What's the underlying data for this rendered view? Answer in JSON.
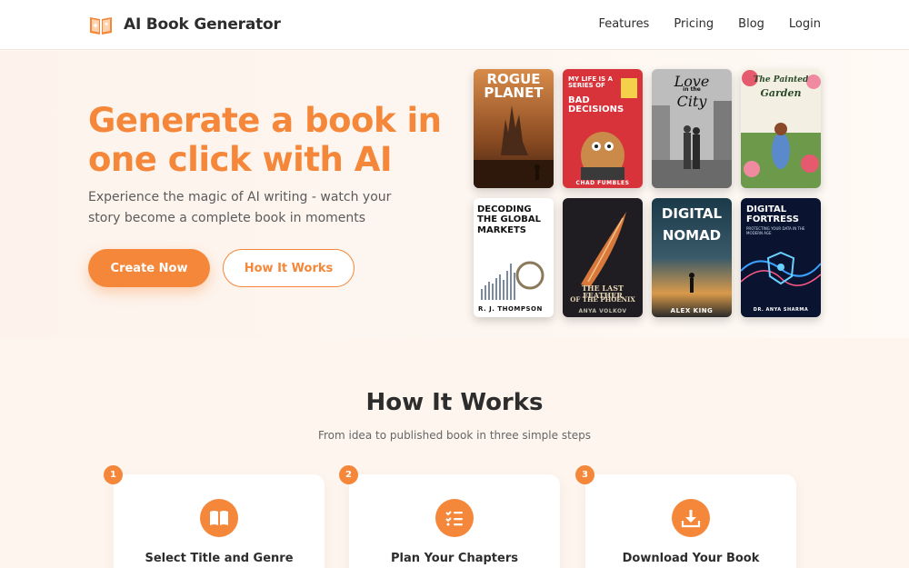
{
  "brand": {
    "name": "AI Book Generator",
    "icon": "open-book-icon"
  },
  "nav": {
    "links": [
      "Features",
      "Pricing",
      "Blog",
      "Login"
    ]
  },
  "hero": {
    "title": "Generate a book in one click with AI",
    "subtitle": "Experience the magic of AI writing - watch your story become a complete book in moments",
    "primary_button": "Create Now",
    "secondary_button": "How It Works"
  },
  "covers": [
    {
      "title_line1": "ROGUE",
      "title_line2": "PLANET",
      "author": ""
    },
    {
      "title_line1": "MY LIFE IS A SERIES OF",
      "title_line2": "BAD DECISIONS",
      "author": "CHAD FUMBLES"
    },
    {
      "title_line1": "Love",
      "title_line2": "City",
      "small": "in the",
      "author": ""
    },
    {
      "title_line1": "The Painted",
      "title_line2": "Garden",
      "author": ""
    },
    {
      "title_line1": "DECODING THE GLOBAL",
      "title_line2": "MARKETS",
      "author": "R. J. THOMPSON"
    },
    {
      "title_line1": "THE LAST FEATHER",
      "title_line2": "OF THE PHOENIX",
      "author": "ANYA VOLKOV"
    },
    {
      "title_line1": "DIGITAL",
      "title_line2": "NOMAD",
      "author": "ALEX KING"
    },
    {
      "title_line1": "DIGITAL",
      "title_line2": "FORTRESS",
      "small": "PROTECTING YOUR DATA IN THE MODERN AGE",
      "author": "DR. ANYA SHARMA"
    }
  ],
  "how_it_works": {
    "title": "How It Works",
    "subtitle": "From idea to published book in three simple steps",
    "steps": [
      {
        "number": "1",
        "label": "Select Title and Genre",
        "icon": "book-icon"
      },
      {
        "number": "2",
        "label": "Plan Your Chapters",
        "icon": "checklist-icon"
      },
      {
        "number": "3",
        "label": "Download Your Book",
        "icon": "download-icon"
      }
    ]
  },
  "colors": {
    "accent": "#f5873a",
    "text": "#2d2d2d",
    "background": "#fffaf5"
  }
}
